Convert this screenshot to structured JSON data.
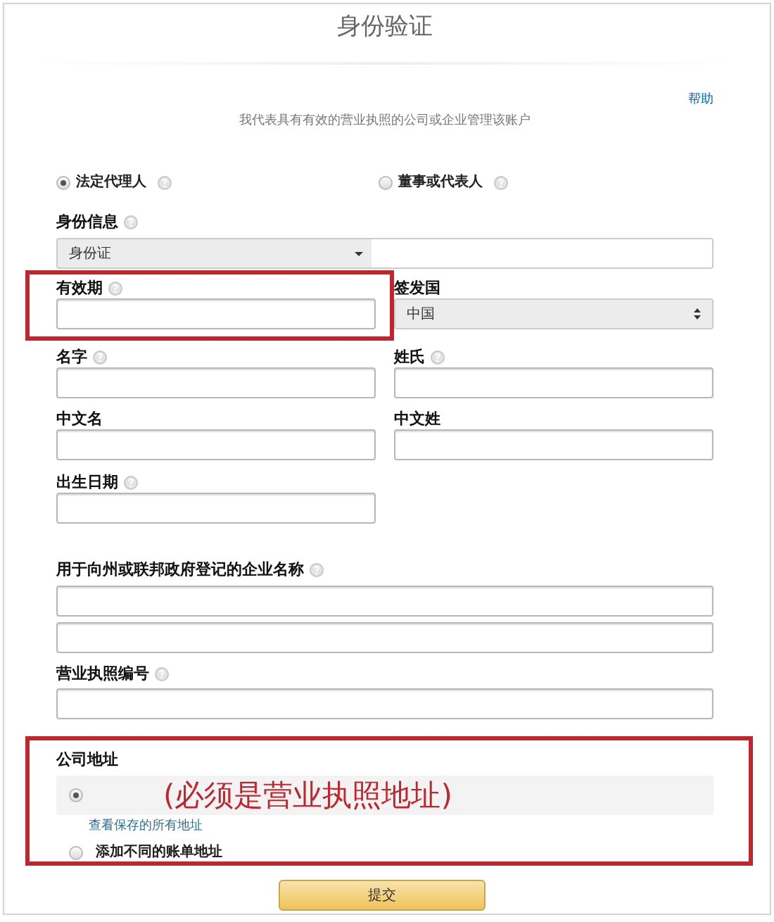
{
  "title": "身份验证",
  "help_link": "帮助",
  "subtitle": "我代表具有有效的营业执照的公司或企业管理该账户",
  "roles": [
    {
      "label": "法定代理人",
      "help": true,
      "selected": true
    },
    {
      "label": "董事或代表人",
      "help": true,
      "selected": false
    }
  ],
  "id_info": {
    "label": "身份信息",
    "help": true,
    "value": "身份证"
  },
  "rows": [
    [
      {
        "kind": "input",
        "label": "有效期",
        "help": true,
        "highlighted": true
      },
      {
        "kind": "select",
        "label": "签发国",
        "help": false,
        "highlighted": false,
        "value": "中国"
      }
    ],
    [
      {
        "kind": "input",
        "label": "名字",
        "help": true,
        "highlighted": false
      },
      {
        "kind": "input",
        "label": "姓氏",
        "help": true,
        "highlighted": false
      }
    ],
    [
      {
        "kind": "input",
        "label": "中文名",
        "help": false,
        "highlighted": false
      },
      {
        "kind": "input",
        "label": "中文姓",
        "help": false,
        "highlighted": false
      }
    ],
    [
      {
        "kind": "input",
        "label": "出生日期",
        "help": true,
        "highlighted": false
      }
    ]
  ],
  "company_name": {
    "label": "用于向州或联邦政府登记的企业名称",
    "help": true,
    "inputs": [
      {
        "kind": "text"
      },
      {
        "kind": "text"
      }
    ]
  },
  "license_number": {
    "label": "营业执照编号",
    "help": true
  },
  "address": {
    "label": "公司地址",
    "highlighted": true,
    "saved_option": {
      "selected": true,
      "note": "(必须是营业执照地址)"
    },
    "view_all_link": "查看保存的所有地址",
    "new_option": {
      "label": "添加不同的账单地址",
      "selected": false
    }
  },
  "submit": "提交"
}
